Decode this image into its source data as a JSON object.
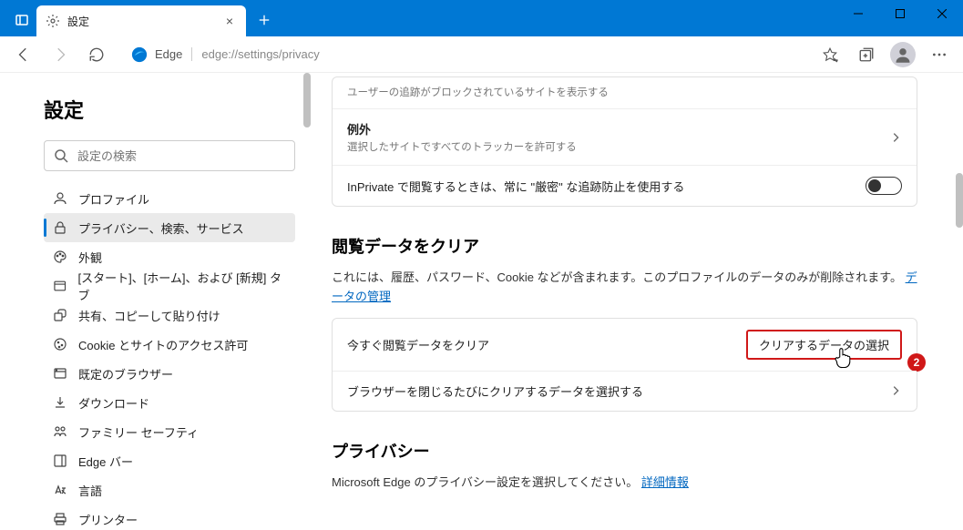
{
  "tab": {
    "title": "設定"
  },
  "address": {
    "label": "Edge",
    "url": "edge://settings/privacy"
  },
  "sidebar": {
    "title": "設定",
    "search_placeholder": "設定の検索",
    "items": [
      {
        "label": "プロファイル"
      },
      {
        "label": "プライバシー、検索、サービス"
      },
      {
        "label": "外観"
      },
      {
        "label": "[スタート]、[ホーム]、および [新規] タブ"
      },
      {
        "label": "共有、コピーして貼り付け"
      },
      {
        "label": "Cookie とサイトのアクセス許可"
      },
      {
        "label": "既定のブラウザー"
      },
      {
        "label": "ダウンロード"
      },
      {
        "label": "ファミリー セーフティ"
      },
      {
        "label": "Edge バー"
      },
      {
        "label": "言語"
      },
      {
        "label": "プリンター"
      }
    ]
  },
  "main": {
    "tracking_row_sub": "ユーザーの追跡がブロックされているサイトを表示する",
    "exceptions_title": "例外",
    "exceptions_sub": "選択したサイトですべてのトラッカーを許可する",
    "inprivate_title": "InPrivate で閲覧するときは、常に \"厳密\" な追跡防止を使用する",
    "clear_header": "閲覧データをクリア",
    "clear_desc_pre": "これには、履歴、パスワード、Cookie などが含まれます。このプロファイルのデータのみが削除されます。",
    "clear_desc_link": "データの管理",
    "clear_now_title": "今すぐ閲覧データをクリア",
    "clear_now_button": "クリアするデータの選択",
    "clear_on_close": "ブラウザーを閉じるたびにクリアするデータを選択する",
    "privacy_header": "プライバシー",
    "privacy_desc_pre": "Microsoft Edge のプライバシー設定を選択してください。",
    "privacy_link": "詳細情報",
    "badge": "2"
  }
}
